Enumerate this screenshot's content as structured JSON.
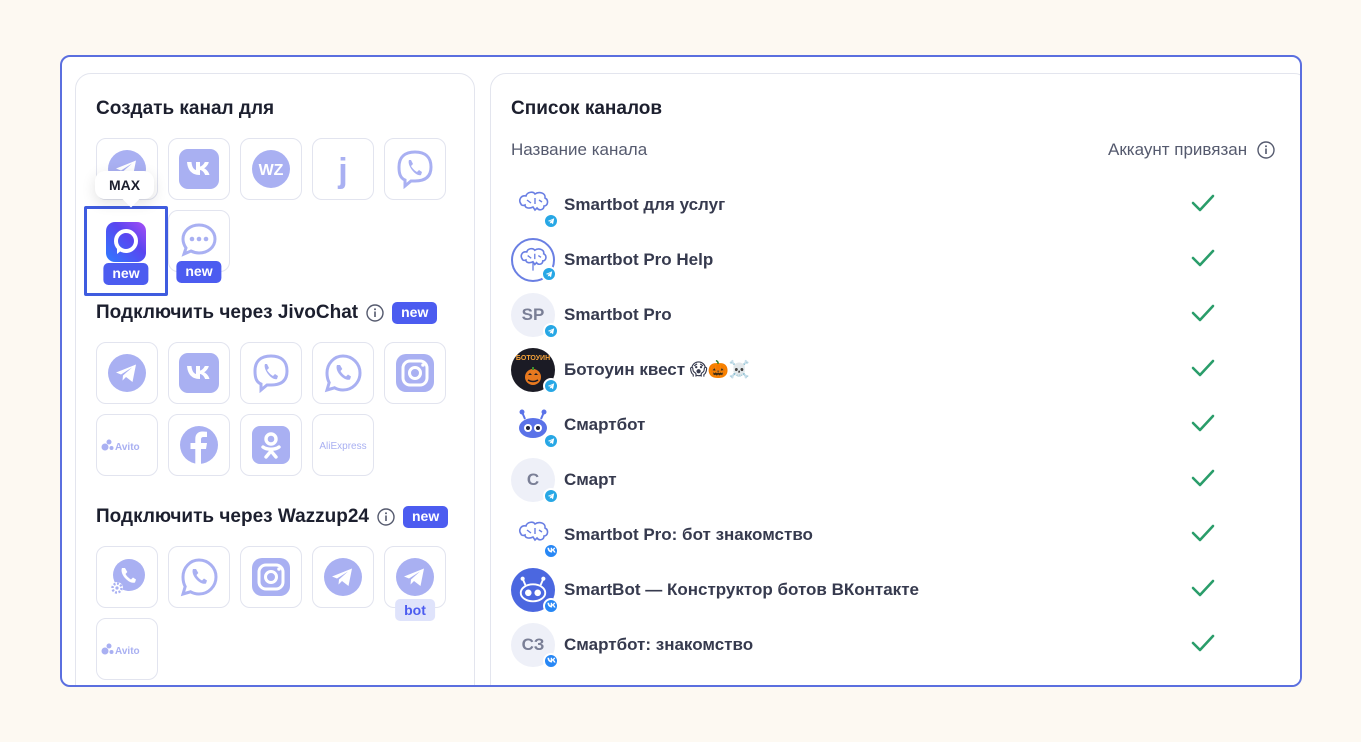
{
  "create_section": {
    "title": "Создать канал для",
    "tooltip": "MAX",
    "tiles": [
      {
        "icon": "telegram-icon"
      },
      {
        "icon": "vk-icon"
      },
      {
        "icon": "wazzup-icon",
        "text": "WZ"
      },
      {
        "icon": "jivo-icon",
        "text": "j"
      },
      {
        "icon": "viber-icon"
      },
      {
        "icon": "max-icon",
        "badge": "new"
      },
      {
        "icon": "chat-bubble-icon",
        "badge": "new"
      }
    ]
  },
  "jivo_section": {
    "title": "Подключить через JivoChat",
    "badge": "new",
    "tiles": [
      {
        "icon": "telegram-icon"
      },
      {
        "icon": "vk-icon"
      },
      {
        "icon": "viber-icon"
      },
      {
        "icon": "whatsapp-icon"
      },
      {
        "icon": "instagram-icon"
      },
      {
        "icon": "avito-icon",
        "text": "Avito"
      },
      {
        "icon": "facebook-icon"
      },
      {
        "icon": "odnoklassniki-icon"
      },
      {
        "icon": "aliexpress-icon",
        "text": "AliExpress"
      }
    ]
  },
  "wazzup_section": {
    "title": "Подключить через Wazzup24",
    "badge": "new",
    "tiles": [
      {
        "icon": "phone-settings-icon"
      },
      {
        "icon": "whatsapp-icon"
      },
      {
        "icon": "instagram-icon"
      },
      {
        "icon": "telegram-icon"
      },
      {
        "icon": "telegram-icon",
        "badge": "bot"
      },
      {
        "icon": "avito-icon",
        "text": "Avito"
      }
    ]
  },
  "channels": {
    "title": "Список каналов",
    "col_name": "Название канала",
    "col_linked": "Аккаунт привязан",
    "rows": [
      {
        "name": "Smartbot для услуг",
        "avatar": "brain-icon",
        "network": "telegram",
        "linked": true
      },
      {
        "name": "Smartbot Pro Help",
        "avatar": "brain-circle-icon",
        "network": "telegram",
        "linked": true
      },
      {
        "name": "Smartbot Pro",
        "avatar_text": "SP",
        "network": "telegram",
        "linked": true
      },
      {
        "name": "Ботоуин квест 😱🎃☠️",
        "avatar": "halloween-avatar",
        "avatar_text": "БОТОУИН",
        "network": "telegram",
        "linked": true
      },
      {
        "name": "Смартбот",
        "avatar": "robot-icon",
        "network": "telegram",
        "linked": true
      },
      {
        "name": "Смарт",
        "avatar_text": "С",
        "network": "telegram",
        "linked": true
      },
      {
        "name": "Smartbot Pro: бот знакомство",
        "avatar": "brain-icon",
        "network": "vk",
        "linked": true
      },
      {
        "name": "SmartBot — Конструктор ботов ВКонтакте",
        "avatar": "robot-circle-icon",
        "network": "vk",
        "linked": true
      },
      {
        "name": "Смартбот: знакомство",
        "avatar_text": "СЗ",
        "network": "vk",
        "linked": true
      }
    ]
  },
  "colors": {
    "accent": "#4c5cf0",
    "icon": "#a9b0f2",
    "check": "#2a9d6a",
    "frame": "#5b6fdf"
  }
}
